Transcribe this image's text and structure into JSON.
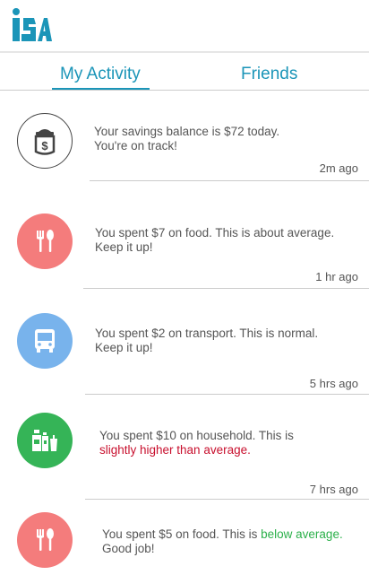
{
  "app": {
    "logo_text": "iSA"
  },
  "tabs": [
    {
      "label": "My Activity",
      "active": true
    },
    {
      "label": "Friends",
      "active": false
    }
  ],
  "colors": {
    "accent": "#1b95b8",
    "food": "#f47c7c",
    "transport": "#78b3ec",
    "household": "#35b457",
    "warning_text": "#c8102e",
    "positive_text": "#2bb04a"
  },
  "feed": [
    {
      "icon": "savings-jar-icon",
      "line1": "Your savings balance is $72 today.",
      "line2": "You're on track!",
      "time": "2m ago"
    },
    {
      "icon": "fork-spoon-icon",
      "line1": "You spent $7 on food. This is about average.",
      "line2": "Keep it up!",
      "time": "1 hr ago"
    },
    {
      "icon": "bus-icon",
      "line1": "You spent $2 on transport. This is normal.",
      "line2": "Keep it up!",
      "time": "5 hrs ago"
    },
    {
      "icon": "household-products-icon",
      "line1": "You spent $10 on household. This is",
      "line2": "slightly higher than average.",
      "time": "7 hrs ago"
    },
    {
      "icon": "fork-spoon-icon",
      "line1_prefix": "You spent $5 on food. This is ",
      "line1_highlight": "below average.",
      "line2": "Good job!"
    }
  ]
}
